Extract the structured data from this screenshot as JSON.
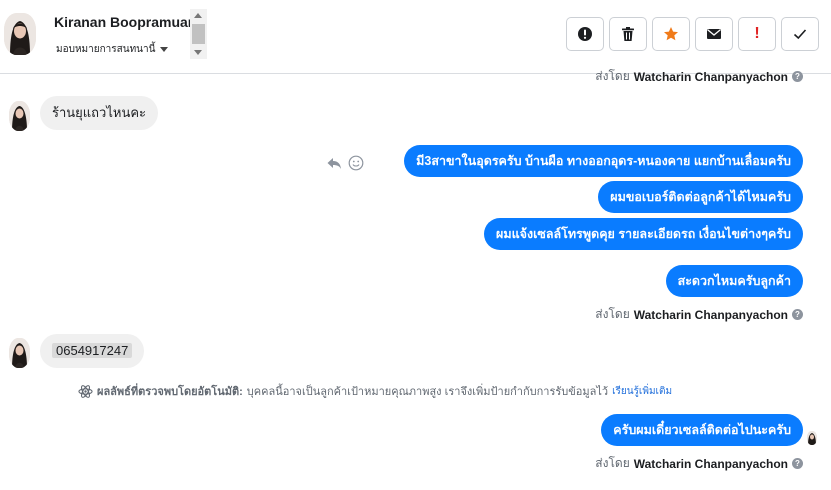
{
  "header": {
    "contact_name": "Kiranan Boopramuan",
    "assign_label": "มอบหมายการสนทนานี้",
    "toolbar": [
      {
        "name": "alert-circle-icon",
        "title": "alert"
      },
      {
        "name": "trash-icon",
        "title": "delete"
      },
      {
        "name": "star-icon",
        "title": "star",
        "color": "#f07b1a"
      },
      {
        "name": "envelope-icon",
        "title": "mark unread"
      },
      {
        "name": "exclamation-icon",
        "title": "important",
        "color": "#e02424"
      },
      {
        "name": "check-icon",
        "title": "done"
      }
    ]
  },
  "conversation": {
    "sent_by_prefix": "ส่งโดย",
    "sender_name": "Watcharin Chanpanyachon",
    "incoming_1": "ร้านยุแถวไหนคะ",
    "outgoing_1": [
      "มี3สาขาในอุดรครับ บ้านผือ ทางออกอุดร-หนองคาย แยกบ้านเลื่อมครับ",
      "ผมขอเบอร์ติดต่อลูกค้าได้ไหมครับ",
      "ผมแจ้งเซลล์โทรพูดคุย รายละเอียดรถ เงื่อนไขต่างๆครับ",
      "สะดวกไหมครับลูกค้า"
    ],
    "incoming_2": "0654917247",
    "auto_detect_label": "ผลลัพธ์ที่ตรวจพบโดยอัตโนมัติ:",
    "auto_detect_text": "บุคคลนี้อาจเป็นลูกค้าเป้าหมายคุณภาพสูง เราจึงเพิ่มป้ายกำกับการรับข้อมูลไว้",
    "learn_more": "เรียนรู้เพิ่มเติม",
    "outgoing_2": "ครับผมเดี๋ยวเซลล์ติดต่อไปนะครับ",
    "bubble_color": "#0a7cff"
  }
}
